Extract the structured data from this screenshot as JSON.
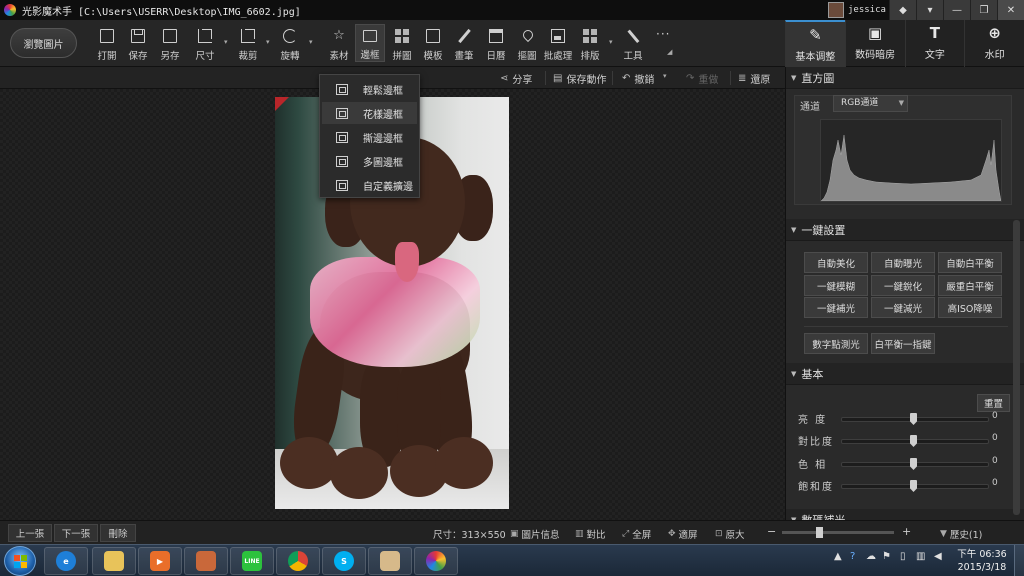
{
  "titlebar": {
    "app_name": "光影魔术手",
    "file_path": "[C:\\Users\\USERR\\Desktop\\IMG_6602.jpg]",
    "user": "jessica",
    "buttons": [
      "◆",
      "▾",
      "—",
      "❐",
      "✕"
    ]
  },
  "toolbar": {
    "browse_label": "瀏覽圖片",
    "tools": [
      {
        "label": "打開"
      },
      {
        "label": "保存"
      },
      {
        "label": "另存"
      },
      {
        "label": "尺寸"
      },
      {
        "label": "裁剪"
      },
      {
        "label": "旋轉"
      },
      {
        "label": "素材"
      },
      {
        "label": "邊框"
      },
      {
        "label": "拼圖"
      },
      {
        "label": "模板"
      },
      {
        "label": "畫筆"
      },
      {
        "label": "日曆"
      },
      {
        "label": "摳圖"
      },
      {
        "label": "批處理"
      },
      {
        "label": "排版"
      },
      {
        "label": "工具"
      }
    ],
    "more_label": "···",
    "active_tool": "邊框"
  },
  "right_tabs": [
    {
      "label": "基本调整",
      "active": true
    },
    {
      "label": "数码暗房",
      "active": false
    },
    {
      "label": "文字",
      "active": false
    },
    {
      "label": "水印",
      "active": false
    }
  ],
  "actionbar": {
    "share": "分享",
    "save_action": "保存動作",
    "undo": "撤銷",
    "redo": "重做",
    "restore": "還原"
  },
  "border_menu": {
    "items": [
      {
        "label": "輕鬆邊框"
      },
      {
        "label": "花樣邊框"
      },
      {
        "label": "撕邊邊框"
      },
      {
        "label": "多圖邊框"
      },
      {
        "label": "自定義擴邊"
      }
    ]
  },
  "panel": {
    "histogram": {
      "title": "直方圖",
      "channel_label": "通道",
      "channel_value": "RGB通道"
    },
    "one_click": {
      "title": "一鍵設置",
      "buttons": [
        [
          "自動美化",
          "自動曝光",
          "自動白平衡"
        ],
        [
          "一鍵模糊",
          "一鍵銳化",
          "嚴重白平衡"
        ],
        [
          "一鍵補光",
          "一鍵減光",
          "高ISO降噪"
        ]
      ],
      "extra": [
        "數字點測光",
        "白平衡一指鍵"
      ]
    },
    "basic": {
      "title": "基本",
      "reset": "重置",
      "sliders": [
        {
          "label": "亮  度",
          "value": 0
        },
        {
          "label": "對比度",
          "value": 0
        },
        {
          "label": "色  相",
          "value": 0
        },
        {
          "label": "飽和度",
          "value": 0
        }
      ],
      "next_section": "數碼補光"
    }
  },
  "bottombar": {
    "prev": "上一張",
    "next": "下一張",
    "delete": "刪除",
    "size": "尺寸：313×550",
    "info": "圖片信息",
    "compare": "對比",
    "fullscreen": "全屏",
    "fit": "適屏",
    "original": "原大",
    "zoom_minus": "−",
    "zoom_plus": "+",
    "history": "歷史(1)"
  },
  "taskbar": {
    "time": "下午 06:36",
    "date": "2015/3/18",
    "apps": [
      "ie",
      "explorer",
      "media",
      "package",
      "line",
      "chrome",
      "skype",
      "paint",
      "lightroom"
    ]
  },
  "colors": {
    "accent": "#3b8fd0",
    "dark_bg": "#1b1b1b",
    "panel_bg": "#2a2a2a"
  }
}
